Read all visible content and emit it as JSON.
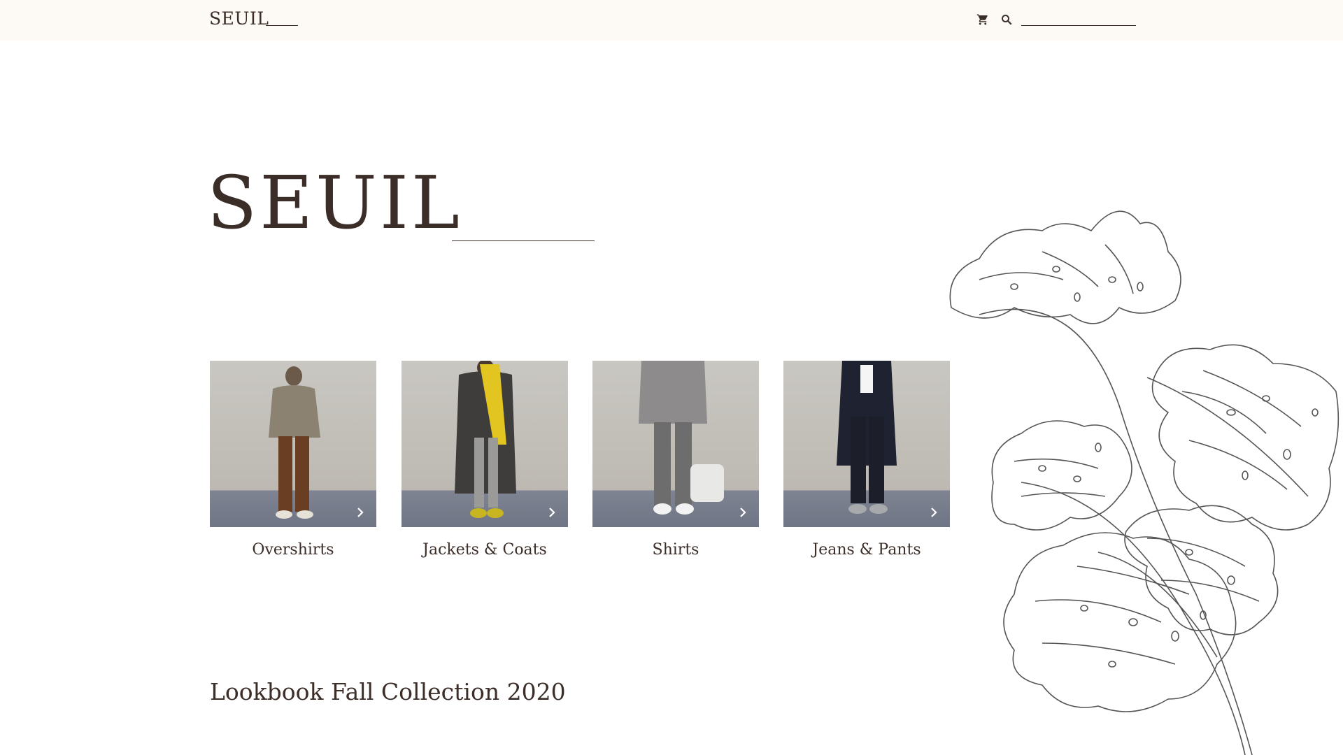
{
  "header": {
    "brand": "SEUIL",
    "cart_icon": "cart-icon",
    "search_icon": "search-icon",
    "search_value": ""
  },
  "hero": {
    "title": "SEUIL"
  },
  "categories": [
    {
      "label": "Overshirts"
    },
    {
      "label": "Jackets & Coats"
    },
    {
      "label": "Shirts"
    },
    {
      "label": "Jeans & Pants"
    }
  ],
  "lookbook": {
    "title": "Lookbook Fall Collection 2020"
  },
  "colors": {
    "text": "#3b2e28",
    "header_bg": "#fdfaf5",
    "background": "#ffffff",
    "plant_stroke": "#555555"
  }
}
